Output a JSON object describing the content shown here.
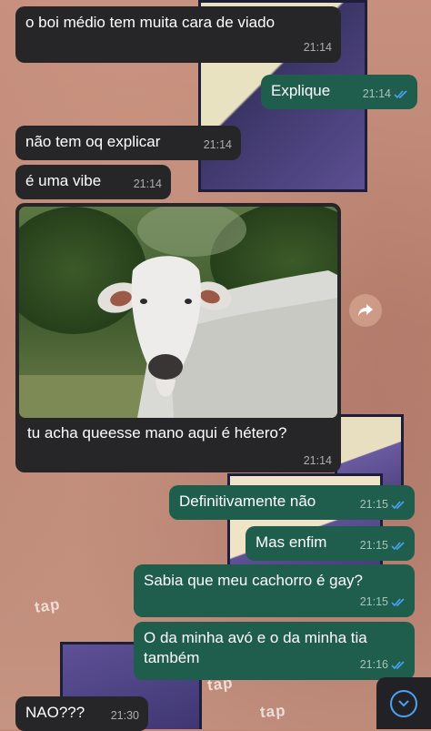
{
  "messages": [
    {
      "text": "o boi médio tem muita cara de viado",
      "time": "21:14"
    },
    {
      "text": "Explique",
      "time": "21:14"
    },
    {
      "text": "não tem oq explicar",
      "time": "21:14"
    },
    {
      "text": "é uma vibe",
      "time": "21:14"
    },
    {
      "text": "tu acha queesse mano aqui é hétero?",
      "time": "21:14"
    },
    {
      "text": "Definitivamente não",
      "time": "21:15"
    },
    {
      "text": "Mas enfim",
      "time": "21:15"
    },
    {
      "text": "Sabia que meu cachorro é gay?",
      "time": "21:15"
    },
    {
      "text": "O da minha avó e o da minha tia também",
      "time": "21:16"
    },
    {
      "text": "NAO???",
      "time": "21:30"
    }
  ],
  "wallpaper": {
    "tap_text": "tap"
  },
  "colors": {
    "incoming": "#262628",
    "outgoing": "#1f5d4c",
    "read_ticks": "#4aa3f4"
  }
}
